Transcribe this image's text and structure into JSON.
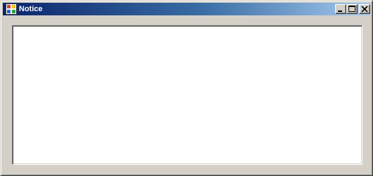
{
  "window": {
    "title": "Notice",
    "icon": "application-icon",
    "controls": {
      "minimize_icon": "minimize-icon",
      "maximize_icon": "maximize-icon",
      "close_icon": "close-icon"
    }
  },
  "content": {
    "text": ""
  },
  "colors": {
    "titlebar_start": "#0a246a",
    "titlebar_end": "#a6caf0",
    "window_face": "#d4d0c8",
    "content_background": "#ffffff"
  }
}
